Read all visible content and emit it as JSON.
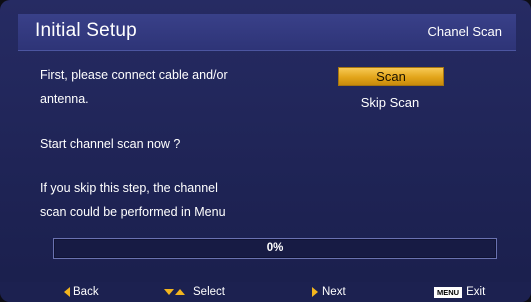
{
  "header": {
    "title": "Initial Setup",
    "subtitle": "Chanel Scan"
  },
  "body": {
    "line1": "First, please connect cable and/or",
    "line2": "antenna.",
    "question": "Start channel scan now ?",
    "skip_line1": "If you skip this step, the channel",
    "skip_line2": "scan could be performed in Menu"
  },
  "buttons": {
    "scan": "Scan",
    "skip": "Skip Scan"
  },
  "progress": {
    "percent_label": "0%",
    "value": 0
  },
  "footer": {
    "back": "Back",
    "select": "Select",
    "next": "Next",
    "menu_key": "MENU",
    "exit": "Exit"
  },
  "colors": {
    "highlight": "#f2b51e",
    "background": "#22275a"
  }
}
